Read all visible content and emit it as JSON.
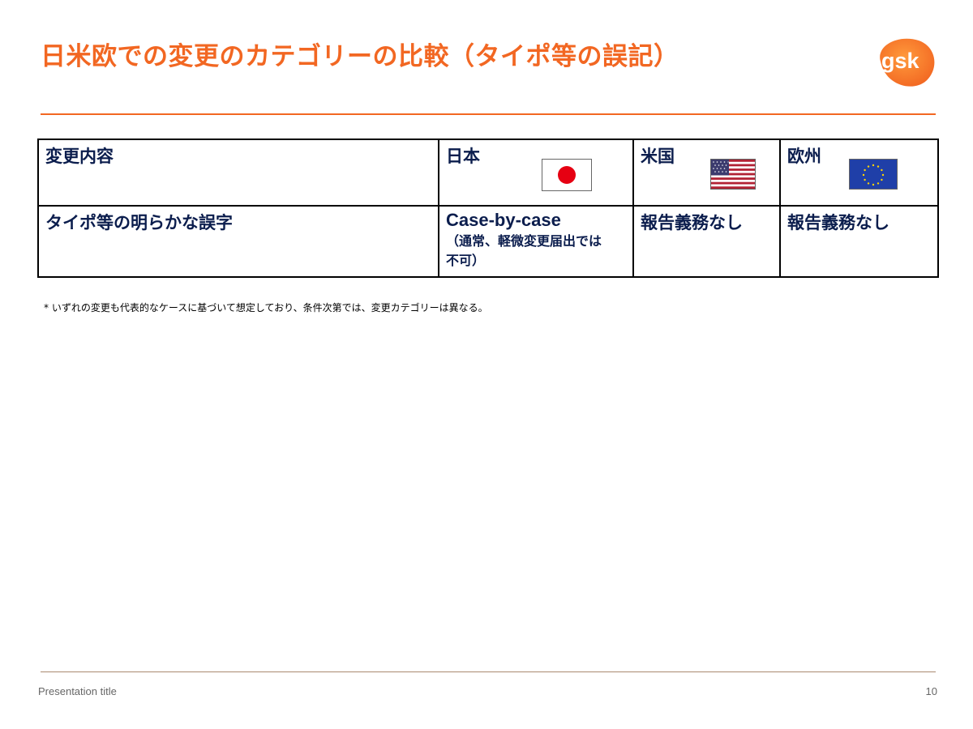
{
  "slide": {
    "title": "日米欧での変更のカテゴリーの比較（タイポ等の誤記）",
    "logo_text": "gsk",
    "accent_color": "#f26722",
    "text_color": "#0b1d4d"
  },
  "table": {
    "headers": {
      "content": "変更内容",
      "japan": "日本",
      "us": "米国",
      "eu": "欧州"
    },
    "flags": {
      "japan": "japan-flag-icon",
      "us": "us-flag-icon",
      "eu": "eu-flag-icon"
    },
    "row": {
      "content": "タイポ等の明らかな誤字",
      "japan_main": "Case-by-case",
      "japan_sub_1": "（通常、軽微変更届出では",
      "japan_sub_2": "不可）",
      "us": "報告義務なし",
      "eu": "報告義務なし"
    }
  },
  "note": "* いずれの変更も代表的なケースに基づいて想定しており、条件次第では、変更カテゴリーは異なる。",
  "footer": {
    "title": "Presentation title",
    "page": "10"
  }
}
